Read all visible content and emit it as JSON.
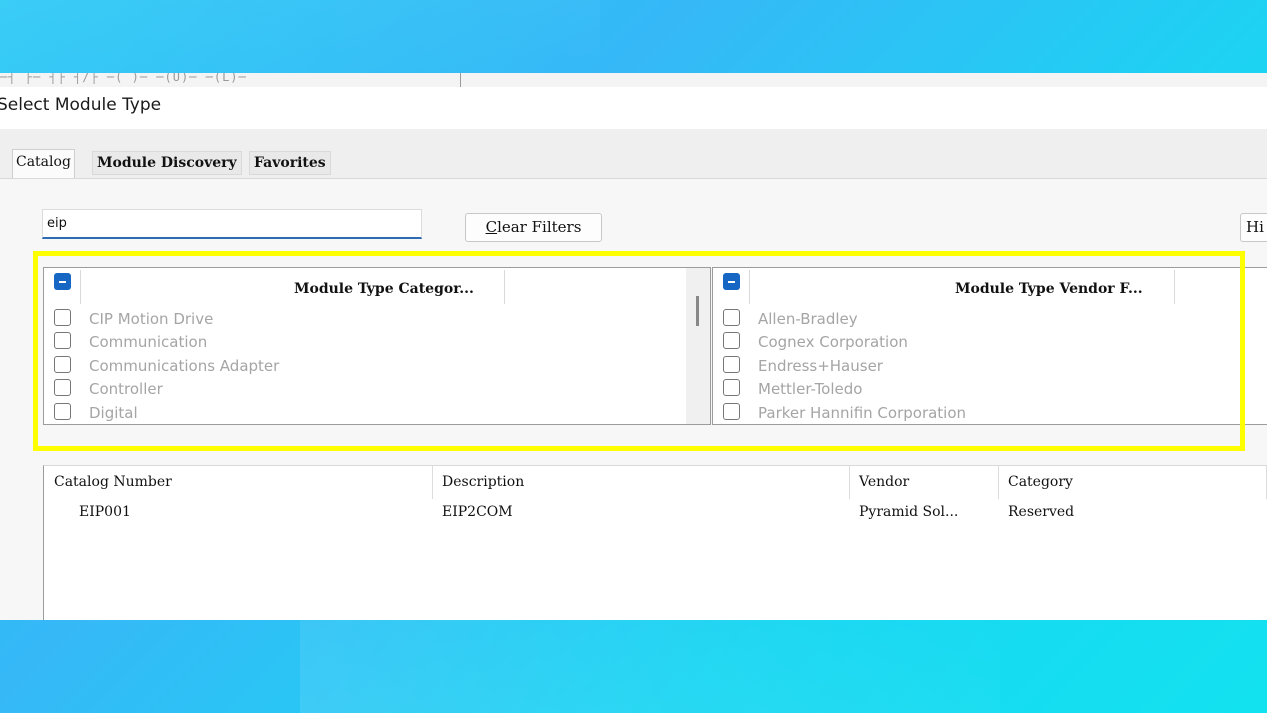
{
  "dialog": {
    "title": "Select Module Type"
  },
  "toolbar": {
    "glyphs": "─┤ ├─  ┤├  ┤/├  ─( )─  ─(U)─  ─(L)─"
  },
  "tabs": [
    {
      "label": "Catalog",
      "active": true
    },
    {
      "label": "Module Discovery",
      "active": false
    },
    {
      "label": "Favorites",
      "active": false
    }
  ],
  "search": {
    "value": "eip"
  },
  "buttons": {
    "clear_filters": "Clear Filters",
    "clear_first": "C",
    "clear_rest": "lear Filters",
    "hide": "Hi"
  },
  "category_filter": {
    "header": "Module Type Categor...",
    "items": [
      "CIP Motion Drive",
      "Communication",
      "Communications Adapter",
      "Controller",
      "Digital"
    ]
  },
  "vendor_filter": {
    "header": "Module Type Vendor F...",
    "items": [
      "Allen-Bradley",
      "Cognex Corporation",
      "Endress+Hauser",
      "Mettler-Toledo",
      "Parker Hannifin Corporation"
    ]
  },
  "results": {
    "columns": [
      "Catalog Number",
      "Description",
      "Vendor",
      "Category"
    ],
    "rows": [
      {
        "catalog_number": "EIP001",
        "description": "EIP2COM",
        "vendor": "Pyramid Sol...",
        "category": "Reserved"
      }
    ]
  },
  "colors": {
    "highlight": "#ffff00",
    "accent": "#1666c4"
  }
}
